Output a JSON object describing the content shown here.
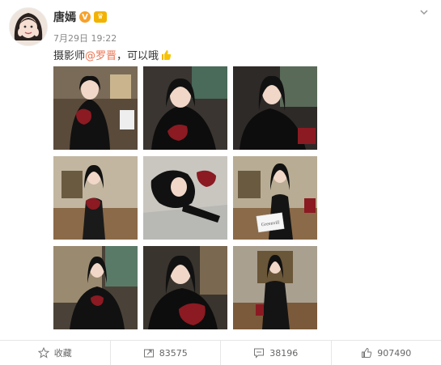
{
  "user": {
    "name": "唐嫣",
    "verified_badge": "V",
    "crown_badge": "♛"
  },
  "post": {
    "time": "7月29日 19:22",
    "text_prefix": "摄影师",
    "mention": "@罗晋",
    "text_suffix": "，可以哦",
    "thumb_icon": "thumbs-up-emoji"
  },
  "photo_card_text": "Greenvill",
  "actions": {
    "collect": "收藏",
    "repost": "83575",
    "comment": "38196",
    "like": "907490"
  },
  "colors": {
    "mention": "#eb7350",
    "badge": "#f7a12a",
    "accent_red": "#8b1a22"
  }
}
